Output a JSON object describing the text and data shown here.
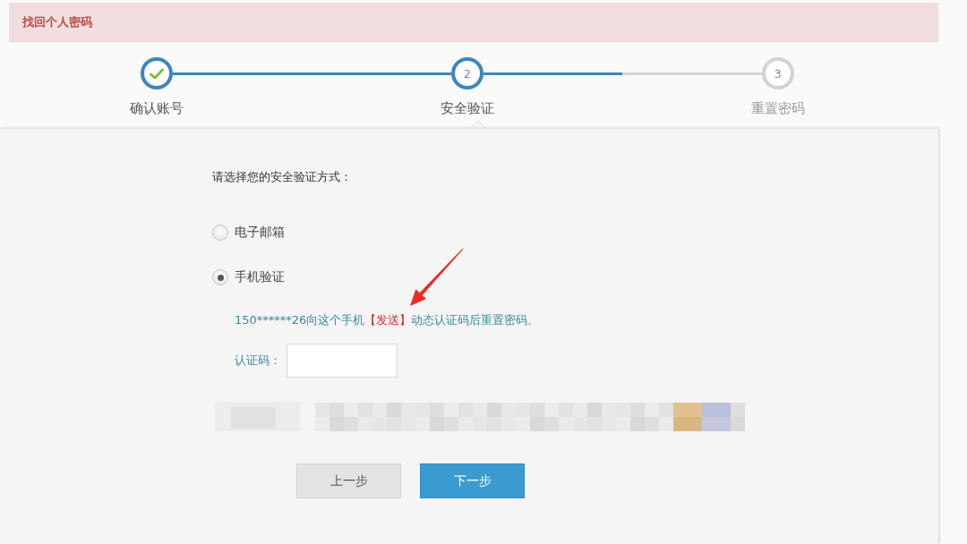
{
  "header": {
    "title": "找回个人密码"
  },
  "steps": [
    {
      "kind": "done",
      "label": "确认账号"
    },
    {
      "kind": "current",
      "number": "2",
      "label": "安全验证"
    },
    {
      "kind": "todo",
      "number": "3",
      "label": "重置密码"
    }
  ],
  "connectors": [
    {
      "level": 1
    },
    {
      "level": 0.5
    }
  ],
  "prompt": "请选择您的安全验证方式：",
  "options": [
    {
      "label": "电子邮箱",
      "selected": false
    },
    {
      "label": "手机验证",
      "selected": true
    }
  ],
  "hint": {
    "text_before": "150******26向这个手机",
    "link": "【发送】",
    "text_after": "动态认证码后重置密码。"
  },
  "code_field": {
    "label": "认证码："
  },
  "pixelated_area": true,
  "buttons": [
    {
      "kind": "secondary",
      "label": "上一步"
    },
    {
      "kind": "primary",
      "label": "下一步"
    }
  ],
  "annotation": {
    "kind": "arrow"
  }
}
